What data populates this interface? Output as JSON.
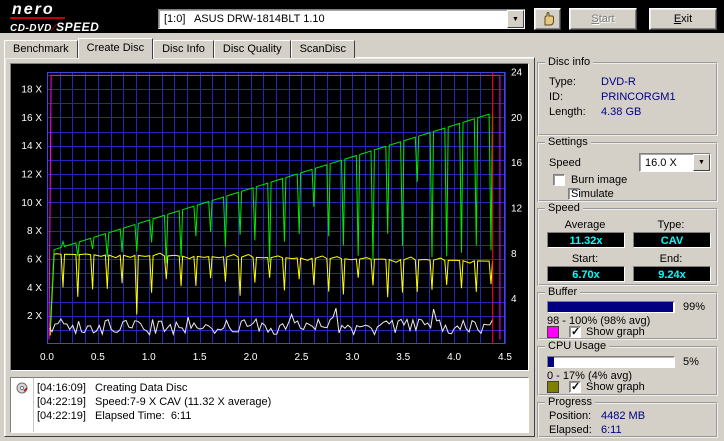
{
  "brand": {
    "name": "nero",
    "sub_left": "CD-DVD",
    "slash": "⁄",
    "sub_right": "SPEED"
  },
  "toolbar": {
    "drive_value": "[1:0]   ASUS DRW-1814BLT 1.10",
    "start_label": "Start",
    "exit_label": "Exit"
  },
  "tabs": [
    {
      "label": "Benchmark",
      "active": false
    },
    {
      "label": "Create Disc",
      "active": true
    },
    {
      "label": "Disc Info",
      "active": false
    },
    {
      "label": "Disc Quality",
      "active": false
    },
    {
      "label": "ScanDisc",
      "active": false
    }
  ],
  "panels": {
    "disc_info": {
      "title": "Disc info",
      "rows": [
        {
          "label": "Type:",
          "value": "DVD-R"
        },
        {
          "label": "ID:",
          "value": "PRINCORGM1"
        },
        {
          "label": "Length:",
          "value": "4.38 GB"
        }
      ]
    },
    "settings": {
      "title": "Settings",
      "speed_label": "Speed",
      "speed_value": "16.0 X",
      "options": [
        {
          "label": "Burn image",
          "checked": false
        },
        {
          "label": "Simulate",
          "checked": false
        }
      ]
    },
    "speed": {
      "title": "Speed",
      "average_label": "Average",
      "type_label": "Type:",
      "average_value": "11.32x",
      "type_value": "CAV",
      "start_label": "Start:",
      "end_label": "End:",
      "start_value": "6.70x",
      "end_value": "9.24x",
      "value_color": "#00ffff"
    },
    "buffer": {
      "title": "Buffer",
      "percent_label": "99%",
      "fill_percent": 99,
      "range_label": "98 - 100% (98% avg)",
      "show_graph_label": "Show graph",
      "show_graph_checked": true,
      "graph_color": "#ff00ff"
    },
    "cpu": {
      "title": "CPU Usage",
      "percent_label": "5%",
      "fill_percent": 5,
      "range_label": "0 - 17% (4% avg)",
      "show_graph_label": "Show graph",
      "show_graph_checked": true,
      "graph_color": "#808000"
    },
    "progress": {
      "title": "Progress",
      "rows": [
        {
          "label": "Position:",
          "value": "4482 MB"
        },
        {
          "label": "Elapsed:",
          "value": "6:11"
        }
      ]
    }
  },
  "log": {
    "rows": [
      {
        "time": "[04:16:09]",
        "message": "Creating Data Disc"
      },
      {
        "time": "[04:22:19]",
        "message": "Speed:7-9 X CAV (11.32 X average)"
      },
      {
        "time": "[04:22:19]",
        "message": "Elapsed Time:  6:11"
      }
    ]
  },
  "chart_data": {
    "type": "line",
    "title": "Create Disc write speed graph",
    "x_axis": {
      "unit": "GB",
      "range": [
        0,
        4.5
      ],
      "ticks": [
        0,
        0.5,
        1,
        1.5,
        2,
        2.5,
        3,
        3.5,
        4,
        4.5
      ],
      "tick_labels": [
        "0.0",
        "0.5",
        "1.0",
        "1.5",
        "2.0",
        "2.5",
        "3.0",
        "3.5",
        "4.0",
        "4.5"
      ]
    },
    "left_axis": {
      "unit": "X",
      "range": [
        0,
        19.2
      ],
      "ticks": [
        2,
        4,
        6,
        8,
        10,
        12,
        14,
        16,
        18
      ],
      "tick_labels": [
        "2 X",
        "4 X",
        "6 X",
        "8 X",
        "10 X",
        "12 X",
        "14 X",
        "16 X",
        "18 X"
      ]
    },
    "right_axis": {
      "range": [
        0,
        24
      ],
      "ticks": [
        4,
        8,
        12,
        16,
        20,
        24
      ],
      "tick_labels": [
        "4",
        "8",
        "12",
        "16",
        "20",
        "24"
      ]
    },
    "grid": {
      "x_step": 0.125,
      "y_step": 1,
      "color": "#2525c0",
      "border": "#4444dd",
      "bg": "#000000"
    },
    "axis_text_color": "#ffffff",
    "end_marker": {
      "x": 4.38,
      "color": "#ff0000"
    },
    "series": [
      {
        "name": "cpu-usage-line",
        "color": "#ebebeb",
        "axis": "right",
        "gen": {
          "kind": "noise",
          "x_start": 0.02,
          "x_end": 4.38,
          "base": 0.8,
          "amp": 1.4,
          "points": 150
        }
      },
      {
        "name": "secondary-speed-line",
        "color": "#ffff00",
        "axis": "left",
        "gen": {
          "kind": "dips",
          "x_start": 0.03,
          "x_end": 4.38,
          "y_start": 6.35,
          "y_end": 5.85,
          "teeth": 30,
          "dip_min": 3.3,
          "dip_max": 4.7,
          "deep_dip_index": 5,
          "deep_dip_y": 2.1
        }
      },
      {
        "name": "write-speed-line",
        "color": "#00e800",
        "axis": "left",
        "gen": {
          "kind": "sawtooth",
          "x_start": 0.03,
          "x_end": 4.38,
          "y_start": 6.5,
          "y_end": 16.3,
          "teeth": 30,
          "dip_min": 5.6,
          "dip_max": 7.8
        }
      },
      {
        "name": "buffer-line",
        "color": "#ff00ff",
        "axis": "right",
        "gen": {
          "kind": "buffer",
          "x_start": 0.02,
          "x_end": 4.45,
          "level": 23.7
        }
      }
    ]
  }
}
